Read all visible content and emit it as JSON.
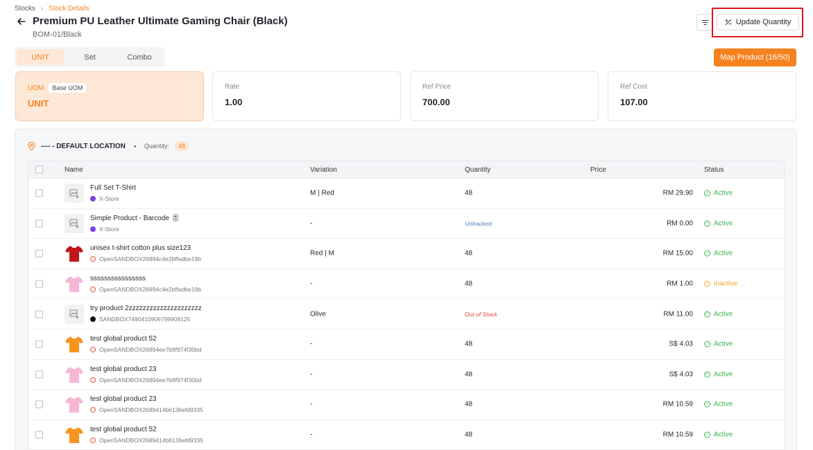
{
  "breadcrumb": {
    "root": "Stocks",
    "current": "Stock Details"
  },
  "header": {
    "title": "Premium PU Leather Ultimate Gaming Chair (Black)",
    "subtitle": "BOM-01/Black",
    "update_label": "Update Quantity"
  },
  "tabs": [
    {
      "label": "UNIT",
      "active": true
    },
    {
      "label": "Set",
      "active": false
    },
    {
      "label": "Combo",
      "active": false
    }
  ],
  "map_button": "Map Product (16/50)",
  "cards": {
    "uom": {
      "label": "UOM",
      "badge": "Base UOM",
      "value": "UNIT"
    },
    "rate": {
      "label": "Rate",
      "value": "1.00"
    },
    "ref_price": {
      "label": "Ref Price",
      "value": "700.00"
    },
    "ref_cost": {
      "label": "Ref Cost",
      "value": "107.00"
    }
  },
  "location": {
    "name": "---- - DEFAULT LOCATION",
    "quantity_label": "Quantity:",
    "quantity": "48"
  },
  "table": {
    "columns": [
      "Name",
      "Variation",
      "Quantity",
      "Price",
      "Status"
    ],
    "rows": [
      {
        "name": "Full Set T-Shirt",
        "store": "X-Store",
        "store_type": "xstore",
        "thumb": "placeholder",
        "variation": "M | Red",
        "quantity": "48",
        "qty_type": "normal",
        "price": "RM 29.90",
        "status": "Active"
      },
      {
        "name": "Simple Product - Barcode 🎚",
        "store": "X-Store",
        "store_type": "xstore",
        "thumb": "placeholder",
        "variation": "-",
        "quantity": "Untracked",
        "qty_type": "untracked",
        "price": "RM 0.00",
        "status": "Active"
      },
      {
        "name": "unisex t-shirt cotton plus size123",
        "store": "OpenSANDBOX26894c4e2bffadbe19b",
        "store_type": "shop",
        "thumb": "red",
        "variation": "Red | M",
        "quantity": "48",
        "qty_type": "normal",
        "price": "RM 15.00",
        "status": "Active"
      },
      {
        "name": "ssssssssssssssss",
        "store": "OpenSANDBOX26894c4e2bffadbe19b",
        "store_type": "shop",
        "thumb": "pink",
        "variation": "-",
        "quantity": "48",
        "qty_type": "normal",
        "price": "RM 1.00",
        "status": "Inactive"
      },
      {
        "name": "try product 2zzzzzzzzzzzzzzzzzzzzz",
        "store": "SANDBOX7490410909799909125",
        "store_type": "tiktok",
        "thumb": "placeholder",
        "variation": "Olive",
        "quantity": "Out of Stock",
        "qty_type": "oos",
        "price": "RM 11.00",
        "status": "Active"
      },
      {
        "name": "test global product 52",
        "store": "OpenSANDBOX26894ee7b9f974f30bd",
        "store_type": "shop",
        "thumb": "orange",
        "variation": "-",
        "quantity": "48",
        "qty_type": "normal",
        "price": "S$ 4.03",
        "status": "Active"
      },
      {
        "name": "test global product 23",
        "store": "OpenSANDBOX26894ee7b9f974f30bd",
        "store_type": "shop",
        "thumb": "pink",
        "variation": "-",
        "quantity": "48",
        "qty_type": "normal",
        "price": "S$ 4.03",
        "status": "Active"
      },
      {
        "name": "test global product 23",
        "store": "OpenSANDBOX2689414b6136efd9335",
        "store_type": "shop",
        "thumb": "pink",
        "variation": "-",
        "quantity": "48",
        "qty_type": "normal",
        "price": "RM 10.59",
        "status": "Active"
      },
      {
        "name": "test global product 52",
        "store": "OpenSANDBOX2689414b6136efd9335",
        "store_type": "shop",
        "thumb": "orange",
        "variation": "-",
        "quantity": "48",
        "qty_type": "normal",
        "price": "RM 10.59",
        "status": "Active"
      }
    ]
  },
  "colors": {
    "accent": "#f5821f",
    "active": "#3bb34a",
    "inactive": "#f5a623",
    "highlight": "#e0141d",
    "shirt_red": "#c0151b",
    "shirt_pink": "#f7b6d6",
    "shirt_orange": "#f7941d"
  }
}
